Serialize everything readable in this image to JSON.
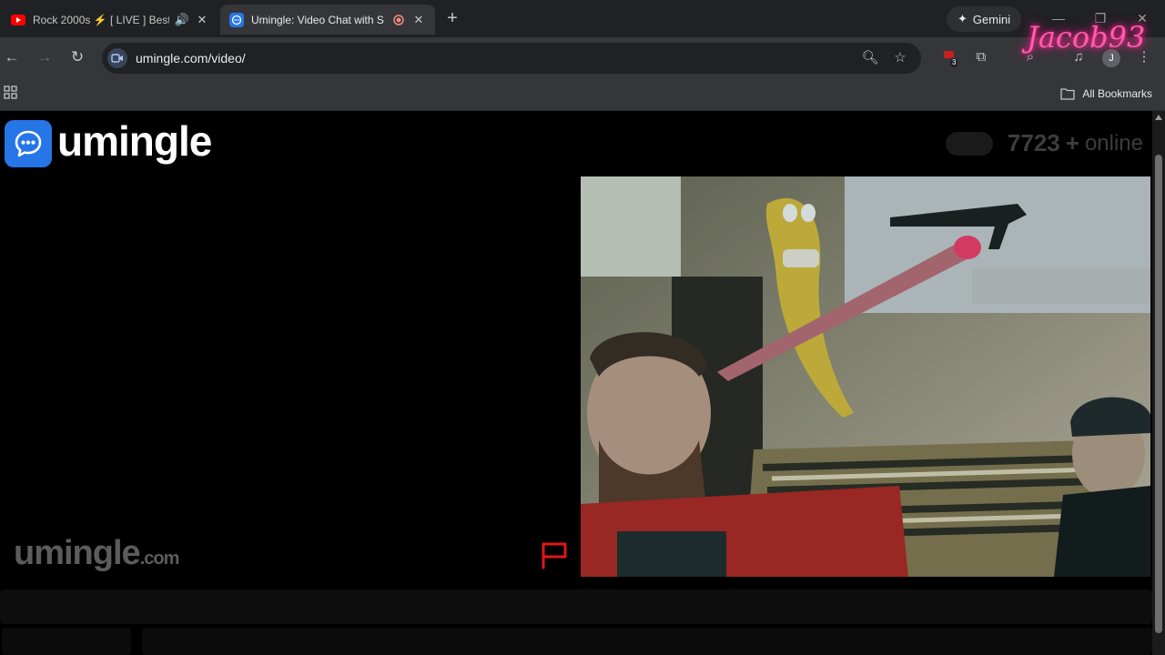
{
  "browser": {
    "tabs": [
      {
        "title": "Rock 2000s ⚡ [ LIVE ] Best",
        "active": false
      },
      {
        "title": "Umingle: Video Chat with S",
        "active": true
      }
    ],
    "gemini_label": "Gemini",
    "url": "umingle.com/video/",
    "extension_badge": "3",
    "profile_initial": "J",
    "all_bookmarks_label": "All Bookmarks"
  },
  "page": {
    "logo_text": "umingle",
    "online": {
      "count": "7723",
      "plus": "+",
      "label": "online"
    },
    "watermark": {
      "name": "umingle",
      "suffix": ".com"
    }
  },
  "overlay": {
    "streamer_name": "Jacob93"
  },
  "colors": {
    "brand_blue": "#2676e8",
    "report_flag": "#e0161e",
    "overlay_pink": "#ff5cab"
  }
}
